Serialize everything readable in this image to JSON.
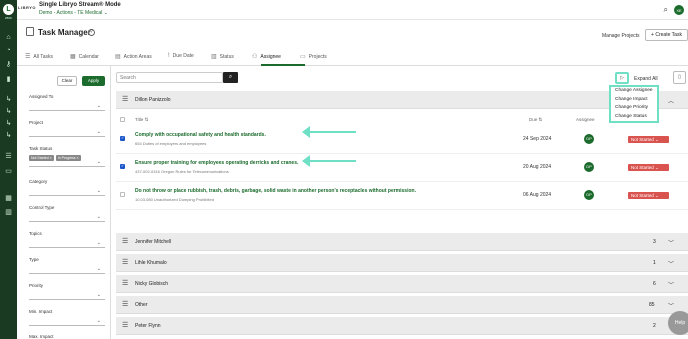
{
  "rail": {
    "logo_letter": "L",
    "logo_caption": "250K",
    "icons": [
      "home-icon",
      "bell-icon",
      "key-icon",
      "trash-icon",
      "arrow-right-icon",
      "arrow-right-icon",
      "arrow-right-icon",
      "arrow-right-icon",
      "list-icon",
      "folder-icon",
      "grid-icon",
      "chart-icon"
    ]
  },
  "topbar": {
    "brand": "LIBRYO",
    "title": "Single Libryo Stream® Mode",
    "subtitle": "Demo - Actions - TE Medical ⌄",
    "avatar": "XE"
  },
  "header": {
    "title": "Task Manager",
    "help": "?",
    "projects_label": "Manage Projects",
    "create_label": "+ Create Task"
  },
  "tabs": [
    {
      "label": "All Tasks",
      "icon": "☰"
    },
    {
      "label": "Calendar",
      "icon": "▦"
    },
    {
      "label": "Action Areas",
      "icon": "▤"
    },
    {
      "label": "Due Date",
      "icon": "!"
    },
    {
      "label": "Status",
      "icon": "▥"
    },
    {
      "label": "Assignee",
      "icon": "⚇"
    },
    {
      "label": "Projects",
      "icon": "▭"
    }
  ],
  "filters": {
    "clear": "Clear",
    "apply": "Apply",
    "fields": [
      {
        "label": "Assigned To"
      },
      {
        "label": "Project"
      },
      {
        "label": "Task Status",
        "chips": [
          "Not Started ×",
          "In Progress ×"
        ]
      },
      {
        "label": "Category"
      },
      {
        "label": "Control Type"
      },
      {
        "label": "Topics"
      },
      {
        "label": "Type"
      },
      {
        "label": "Priority"
      },
      {
        "label": "Min. Impact"
      },
      {
        "label": "Max. Impact"
      }
    ]
  },
  "toolbar": {
    "search_placeholder": "Search",
    "search_icon": "⌕",
    "play_icon": "▷",
    "expand_all": "Expand All",
    "export_icon": "▯"
  },
  "dropdown": [
    "Change Assignee",
    "Change Impact",
    "Change Priority",
    "Change Status"
  ],
  "columns": {
    "title": "Title ⇅",
    "due": "Due ⇅",
    "assignee": "Assignee"
  },
  "groups": [
    {
      "name": "Dillon Panizzolo",
      "count": "",
      "chev": "︿"
    },
    {
      "name": "Jennifer Mitchell",
      "count": "3",
      "chev": "﹀"
    },
    {
      "name": "Lihle Khumalo",
      "count": "1",
      "chev": "﹀"
    },
    {
      "name": "Nicky Globisch",
      "count": "6",
      "chev": "﹀"
    },
    {
      "name": "Other",
      "count": "85",
      "chev": "﹀"
    },
    {
      "name": "Peter Flynn",
      "count": "2",
      "chev": "﹀"
    }
  ],
  "rows": [
    {
      "title": "Comply with occupational safety and health standards.",
      "sub": "654 Duties of employers and employees",
      "due": "24 Sep 2024",
      "assignee": "DP",
      "status": "Not Started ⌄",
      "checked": true
    },
    {
      "title": "Ensure proper training for employees operating derricks and cranes.",
      "sub": "437-002-0316 Oregon Rules for Telecommunications",
      "due": "20 Aug 2024",
      "assignee": "DP",
      "status": "Not Started ⌄",
      "checked": true
    },
    {
      "title": "Do not throw or place rubbish, trash, debris, garbage, solid waste in another person's receptacles without permission.",
      "sub": "10.03.080 Unauthorized Dumping Prohibited",
      "due": "06 Aug 2024",
      "assignee": "DP",
      "status": "Not Started ⌄",
      "checked": false
    }
  ],
  "help": "Help",
  "colors": {
    "brand": "#1b6b2c",
    "accent_highlight": "#6fe0c6",
    "status_red": "#d9534f"
  }
}
